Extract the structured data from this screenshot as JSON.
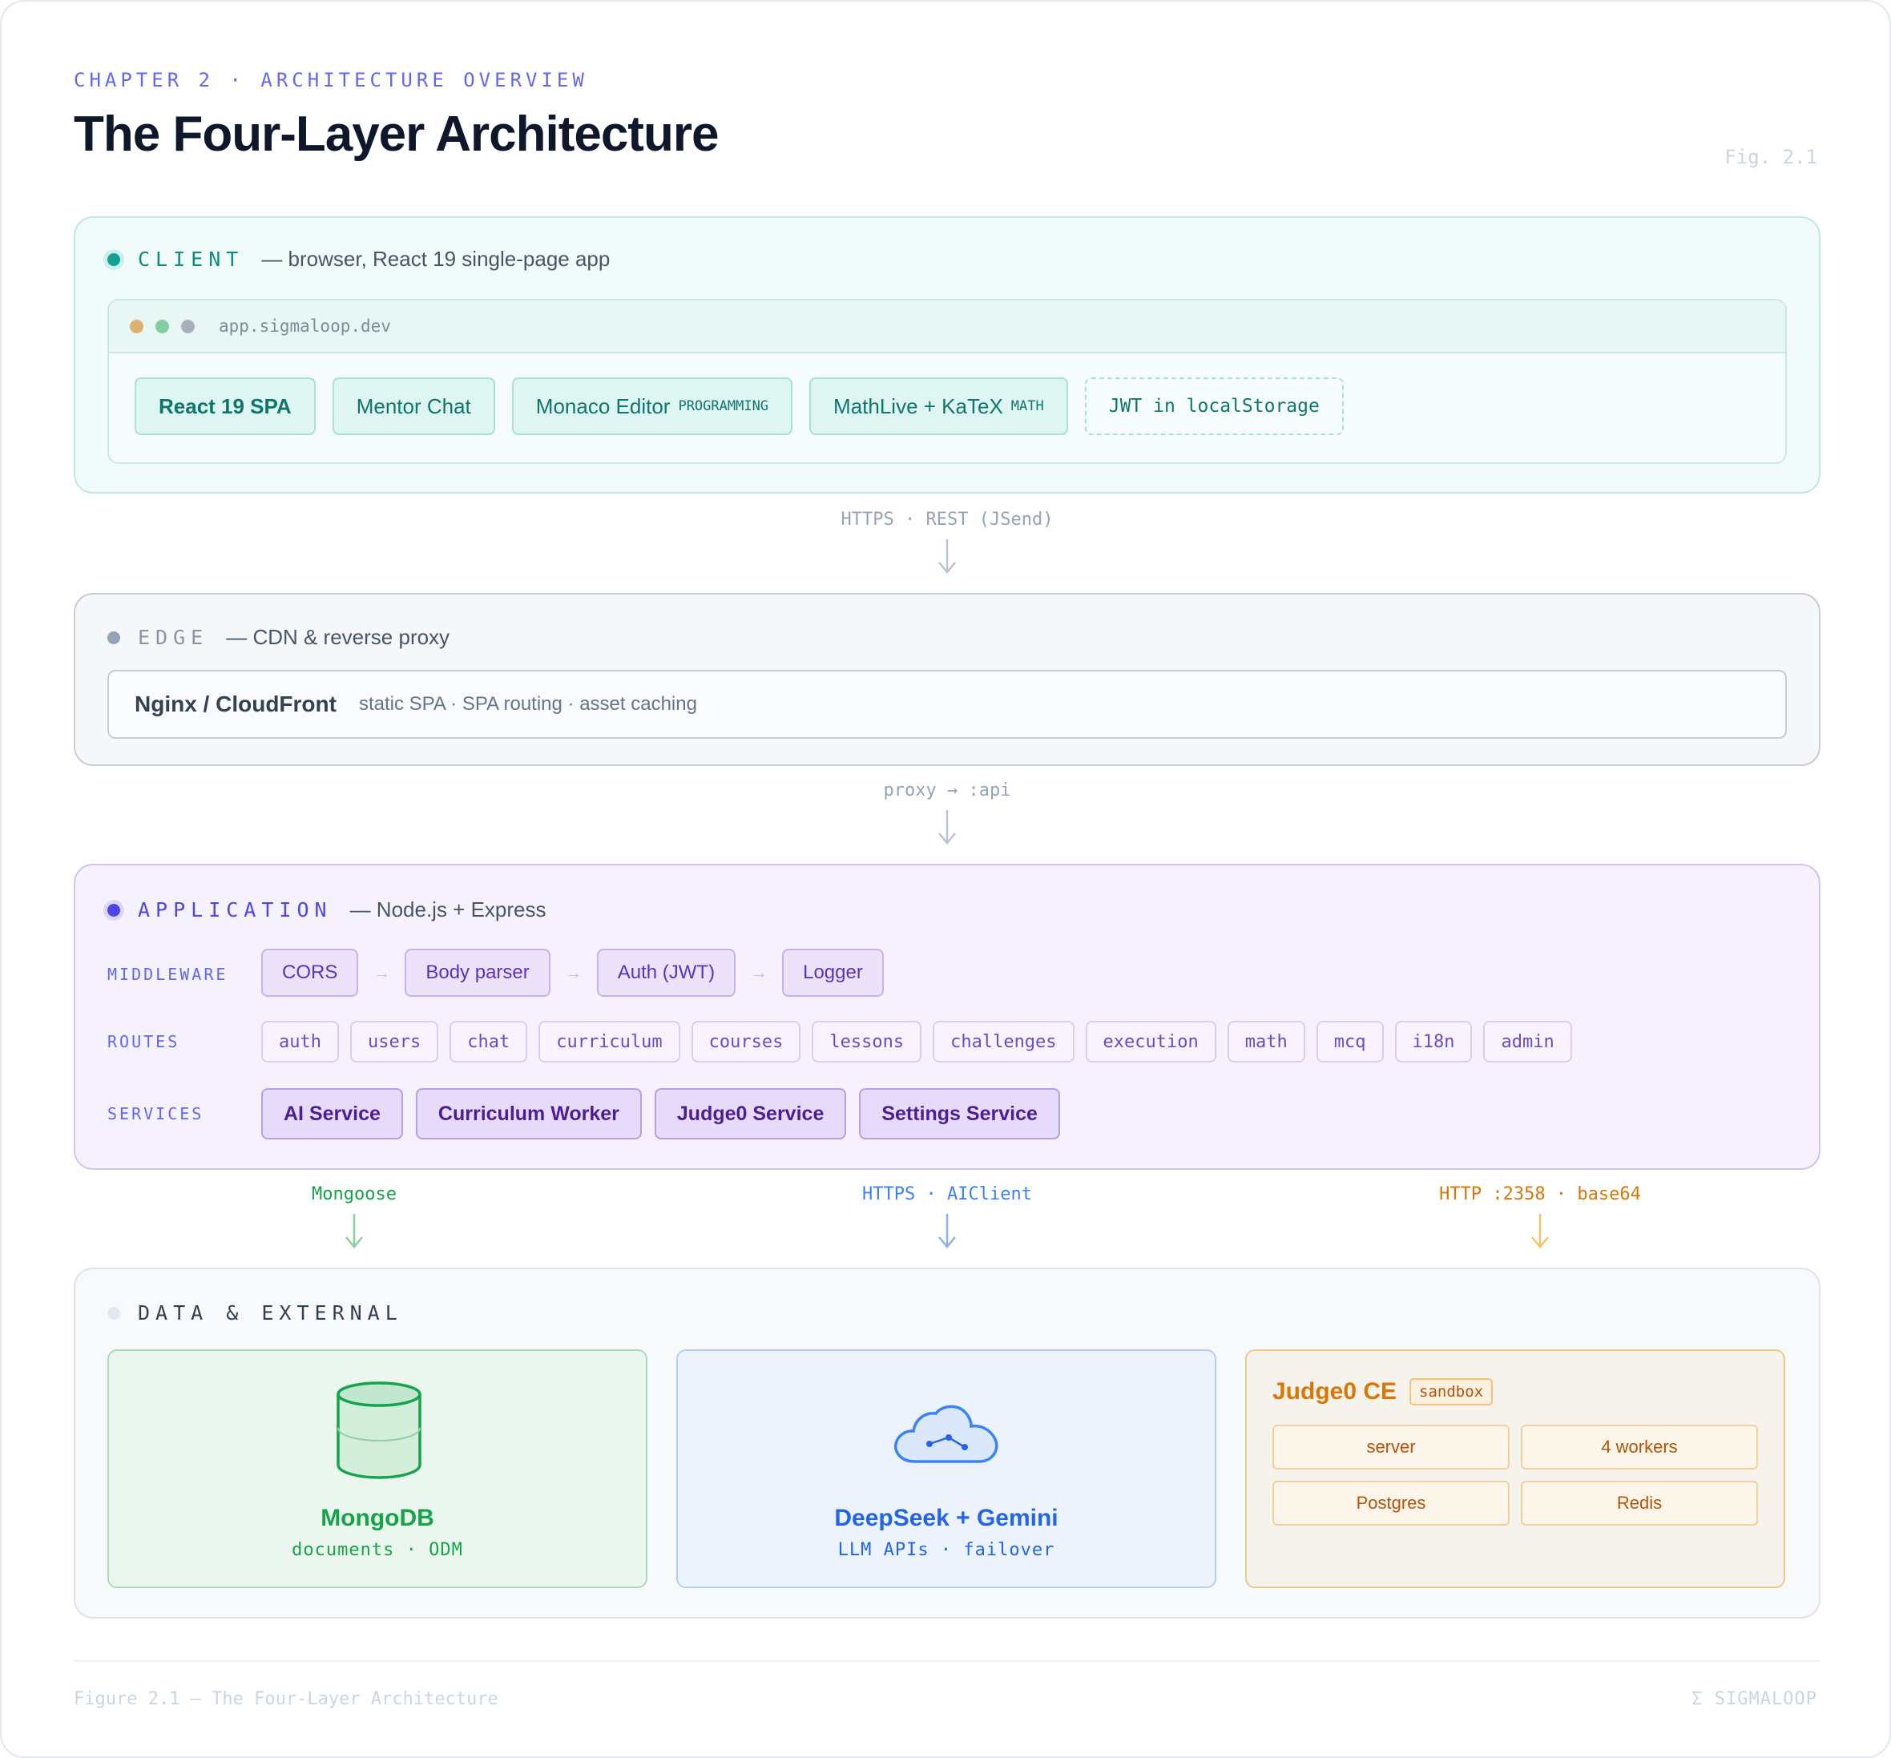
{
  "header": {
    "chapter": "CHAPTER 2 · ARCHITECTURE OVERVIEW",
    "title": "The Four-Layer Architecture",
    "fig": "Fig. 2.1"
  },
  "client": {
    "name": "CLIENT",
    "desc": "— browser, React 19 single-page app",
    "url": "app.sigmaloop.dev",
    "chips": [
      {
        "label": "React 19 SPA",
        "tag": ""
      },
      {
        "label": "Mentor Chat",
        "tag": ""
      },
      {
        "label": "Monaco Editor",
        "tag": "PROGRAMMING"
      },
      {
        "label": "MathLive + KaTeX",
        "tag": "MATH"
      },
      {
        "label": "JWT in localStorage",
        "tag": ""
      }
    ]
  },
  "connectors": {
    "client_edge": "HTTPS · REST (JSend)",
    "edge_app": "proxy → :api",
    "mongoose": "Mongoose",
    "aiclient": "HTTPS · AIClient",
    "judge0": "HTTP :2358 · base64"
  },
  "edge": {
    "name": "EDGE",
    "desc": "— CDN & reverse proxy",
    "box_name": "Nginx / CloudFront",
    "box_desc": "static SPA · SPA routing · asset caching"
  },
  "application": {
    "name": "APPLICATION",
    "desc": "— Node.js + Express",
    "middleware_label": "MIDDLEWARE",
    "middleware": [
      "CORS",
      "Body parser",
      "Auth (JWT)",
      "Logger"
    ],
    "arrow": "→",
    "routes_label": "ROUTES",
    "routes": [
      "auth",
      "users",
      "chat",
      "curriculum",
      "courses",
      "lessons",
      "challenges",
      "execution",
      "math",
      "mcq",
      "i18n",
      "admin"
    ],
    "services_label": "SERVICES",
    "services": [
      "AI Service",
      "Curriculum Worker",
      "Judge0 Service",
      "Settings Service"
    ]
  },
  "data": {
    "name": "DATA & EXTERNAL",
    "mongo": {
      "title": "MongoDB",
      "sub": "documents · ODM"
    },
    "llm": {
      "title": "DeepSeek + Gemini",
      "sub": "LLM APIs · failover"
    },
    "judge": {
      "title": "Judge0 CE",
      "badge": "sandbox",
      "cells": [
        "server",
        "4 workers",
        "Postgres",
        "Redis"
      ]
    }
  },
  "footer": {
    "caption": "Figure 2.1 — The Four-Layer Architecture",
    "brand": "Σ SIGMALOOP"
  },
  "colors": {
    "client": "#0f8a7c",
    "application": "#4f46e5",
    "mongo": "#16a34a",
    "llm": "#2563eb",
    "judge": "#d97706"
  }
}
